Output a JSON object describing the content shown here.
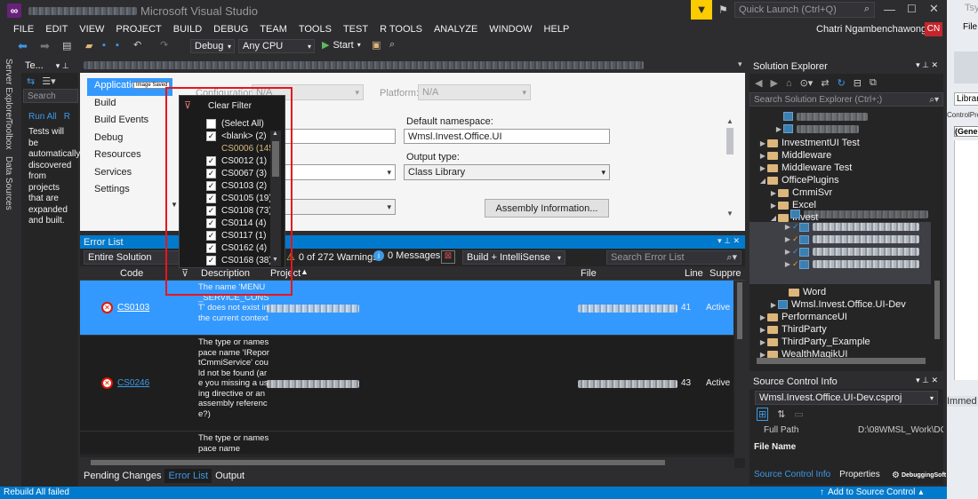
{
  "title": {
    "app": "Microsoft Visual Studio",
    "quick_launch_placeholder": "Quick Launch (Ctrl+Q)",
    "user": "Chatri Ngambenchawong",
    "user_initials": "CN",
    "blurred_name": "WmslOfficeApp...le"
  },
  "menu": [
    "FILE",
    "EDIT",
    "VIEW",
    "PROJECT",
    "BUILD",
    "DEBUG",
    "TEAM",
    "TOOLS",
    "TEST",
    "R TOOLS",
    "ANALYZE",
    "WINDOW",
    "HELP"
  ],
  "toolbar": {
    "config": "Debug",
    "platform": "Any CPU",
    "start": "Start"
  },
  "left_strip": {
    "server_explorer": "Server Explorer",
    "toolbox": "Toolbox",
    "data_sources": "Data Sources"
  },
  "test_panel": {
    "title": "Te...",
    "search": "Search",
    "run_all": "Run All",
    "r_link": "R",
    "message": "Tests will be automatically discovered from projects that are expanded and built."
  },
  "props": {
    "nav": [
      "Application",
      "Build",
      "Build Events",
      "Debug",
      "Resources",
      "Services",
      "Settings"
    ],
    "nav_tooltip": "Image Saved",
    "configuration_label": "Configuration:",
    "configuration_value": "N/A",
    "platform_label": "Platform:",
    "platform_value": "N/A",
    "default_namespace_label": "Default namespace:",
    "default_namespace_value": "Wmsl.Invest.Office.UI",
    "output_type_label": "Output type:",
    "output_type_value": "Class Library",
    "assembly_button": "Assembly Information..."
  },
  "filter_popup": {
    "clear_filter": "Clear Filter",
    "items": [
      {
        "label": "(Select All)",
        "checked": false
      },
      {
        "label": "<blank> (2)",
        "checked": true
      },
      {
        "label": "CS0006 (145)",
        "checked": false,
        "highlight": true
      },
      {
        "label": "CS0012 (1)",
        "checked": true
      },
      {
        "label": "CS0067 (3)",
        "checked": true
      },
      {
        "label": "CS0103 (2)",
        "checked": true
      },
      {
        "label": "CS0105 (19)",
        "checked": true
      },
      {
        "label": "CS0108 (73)",
        "checked": true
      },
      {
        "label": "CS0114 (4)",
        "checked": true
      },
      {
        "label": "CS0117 (1)",
        "checked": true
      },
      {
        "label": "CS0162 (4)",
        "checked": true
      },
      {
        "label": "CS0168 (38)",
        "checked": true
      }
    ]
  },
  "error_list": {
    "title": "Error List",
    "scope": "Entire Solution",
    "warnings": "0 of 272 Warnings",
    "messages": "0 Messages",
    "build_filter": "Build + IntelliSense",
    "search_placeholder": "Search Error List",
    "columns": {
      "code": "Code",
      "description": "Description",
      "project": "Project",
      "file": "File",
      "line": "Line",
      "suppression": "Suppre"
    },
    "rows": [
      {
        "code": "CS0103",
        "description": "The name 'MENU_SERVICE_CONST' does not exist in the current context",
        "line": "41",
        "state": "Active",
        "selected": true
      },
      {
        "code": "CS0246",
        "description": "The type or namespace name 'IReportCmmiService' could not be found (are you missing a using directive or an assembly reference?)",
        "line": "43",
        "state": "Active",
        "selected": false
      },
      {
        "code": "",
        "description": "The type or namespace name",
        "line": "",
        "state": "",
        "selected": false
      }
    ]
  },
  "bottom_tabs": [
    "Pending Changes",
    "Error List",
    "Output"
  ],
  "solution_explorer": {
    "title": "Solution Explorer",
    "search_placeholder": "Search Solution Explorer (Ctrl+;)",
    "items": [
      {
        "label": "InvestmentUI Test",
        "type": "folder",
        "indent": 1,
        "expanded": false
      },
      {
        "label": "Middleware",
        "type": "folder",
        "indent": 1,
        "expanded": false
      },
      {
        "label": "Middleware Test",
        "type": "folder",
        "indent": 1,
        "expanded": false
      },
      {
        "label": "OfficePlugins",
        "type": "folder",
        "indent": 1,
        "expanded": true
      },
      {
        "label": "CmmiSvr",
        "type": "folder",
        "indent": 2,
        "expanded": false
      },
      {
        "label": "Excel",
        "type": "folder",
        "indent": 2,
        "expanded": false
      },
      {
        "label": "Invest",
        "type": "folder",
        "indent": 2,
        "expanded": true
      },
      {
        "label": "Word",
        "type": "folder",
        "indent": 3,
        "expanded": null
      },
      {
        "label": "Wmsl.Invest.Office.UI-Dev",
        "type": "project",
        "indent": 2,
        "expanded": false
      },
      {
        "label": "PerformanceUI",
        "type": "folder",
        "indent": 1,
        "expanded": false
      },
      {
        "label": "ThirdParty",
        "type": "folder",
        "indent": 1,
        "expanded": false
      },
      {
        "label": "ThirdParty_Example",
        "type": "folder",
        "indent": 1,
        "expanded": false
      },
      {
        "label": "WealthMagikUI",
        "type": "folder",
        "indent": 1,
        "expanded": false
      }
    ]
  },
  "source_control": {
    "title": "Source Control Info",
    "project": "Wmsl.Invest.Office.UI-Dev.csproj",
    "full_path_label": "Full Path",
    "full_path_value": "D:\\08WMSL_Work\\DOTN",
    "file_name_label": "File Name",
    "tab_active": "Source Control Info",
    "tab_other": "Properties"
  },
  "status": {
    "left": "Rebuild All failed",
    "right": "Add to Source Control"
  },
  "watermark": "DebuggingSoft",
  "right_edge": {
    "title": "Tsy",
    "file": "File",
    "libra": "Librar",
    "control": "ControlPro",
    "gen": "(Gene",
    "immed": "Immed"
  }
}
